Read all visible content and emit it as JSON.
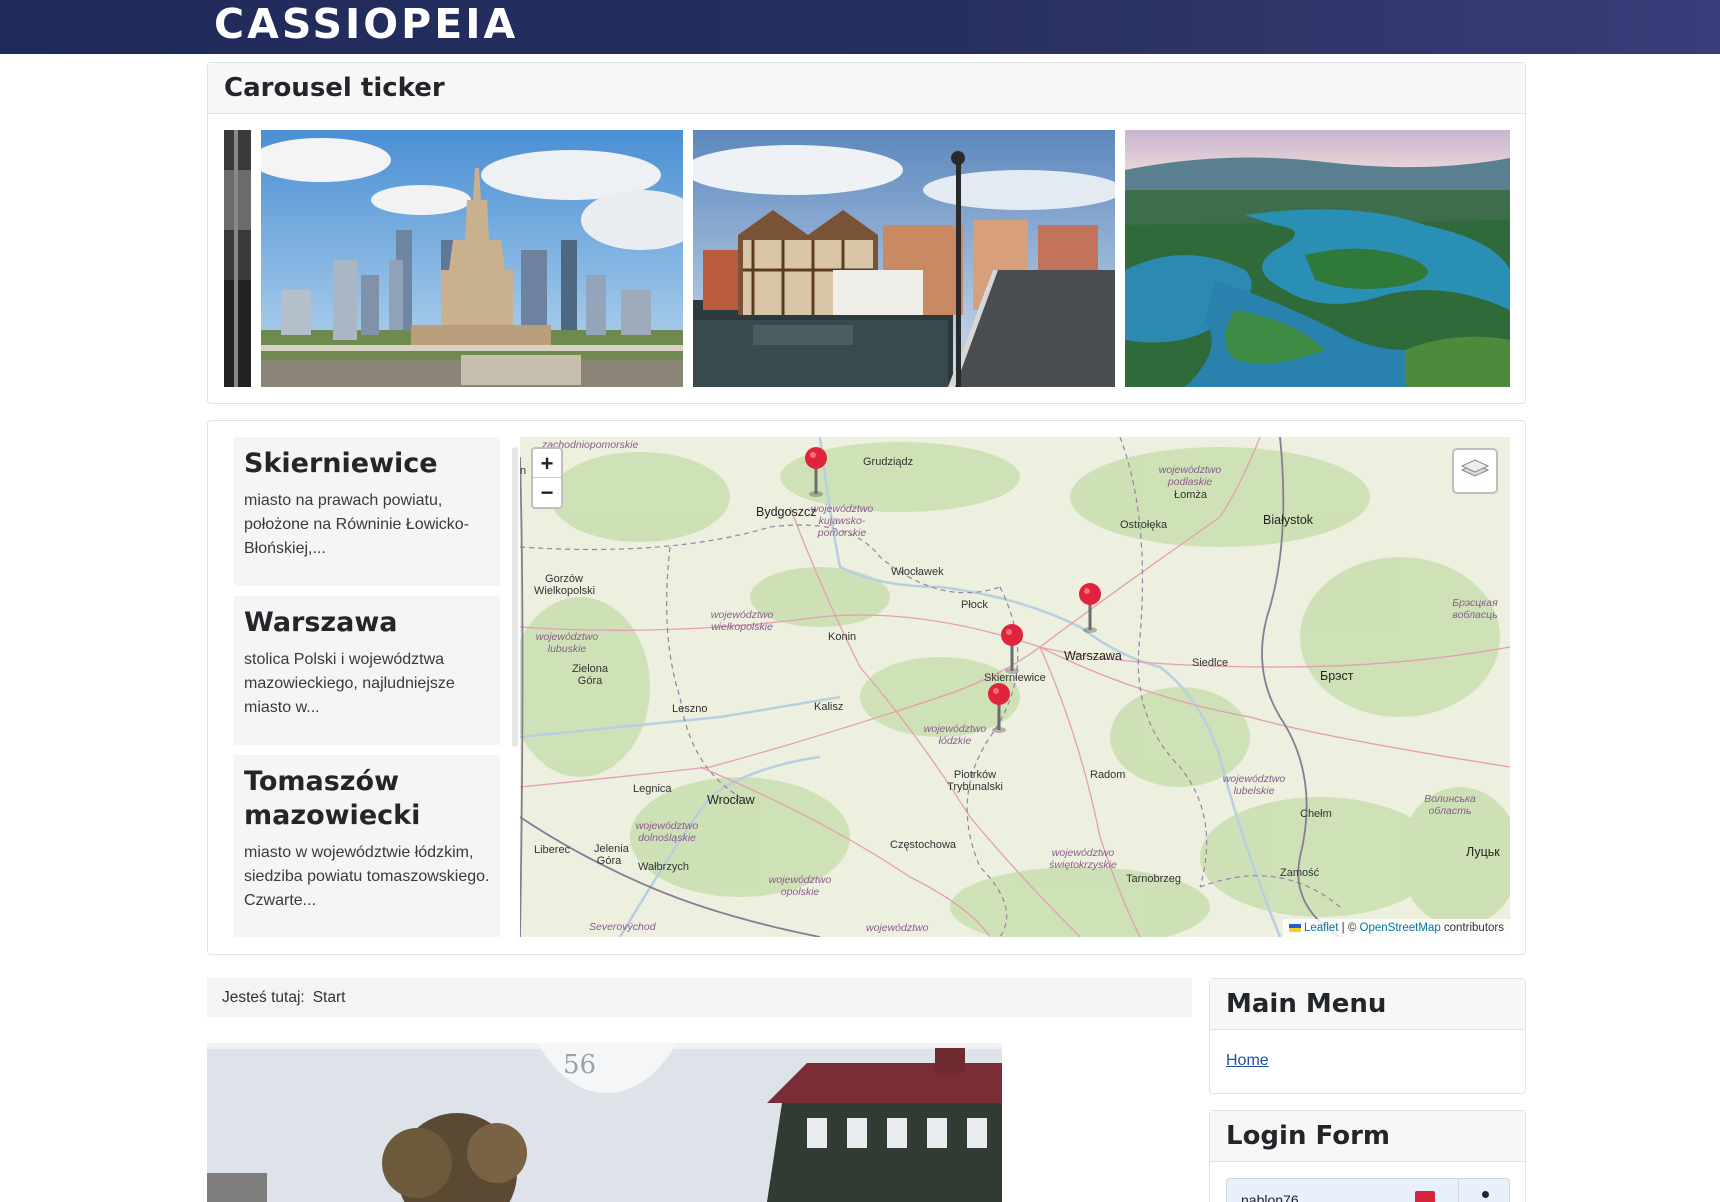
{
  "header": {
    "brand": "CASSIOPEIA"
  },
  "carousel": {
    "title": "Carousel ticker"
  },
  "cities": [
    {
      "name": "Skierniewice",
      "desc": "miasto na prawach powiatu, położone na Równinie Łowicko-Błońskiej,..."
    },
    {
      "name": "Warszawa",
      "desc": "stolica Polski i województwa mazowieckiego, najludniejsze miasto w..."
    },
    {
      "name": "Tomaszów mazowiecki",
      "desc": "miasto w województwie łódzkim, siedziba powiatu tomaszowskiego. Czwarte..."
    }
  ],
  "map": {
    "zoom_in": "+",
    "zoom_out": "−",
    "attribution": {
      "leaflet": "Leaflet",
      "sep": " | © ",
      "osm": "OpenStreetMap",
      "contrib": " contributors"
    },
    "places": {
      "grudziadz": "Grudziądz",
      "bydgoszcz": "Bydgoszcz",
      "lomza": "Łomża",
      "ostroleka": "Ostrołęka",
      "bialystok": "Białystok",
      "gorzow": "Gorzów Wielkopolski",
      "wloclawek": "Włocławek",
      "plock": "Płock",
      "konin": "Konin",
      "warszawa": "Warszawa",
      "siedlce": "Siedlce",
      "brest": "Брэст",
      "zielona": "Zielona Góra",
      "skierniewice": "Skierniewice",
      "leszno": "Leszno",
      "kalisz": "Kalisz",
      "piotrkow": "Piotrków Trybunalski",
      "radom": "Radom",
      "legnica": "Legnica",
      "wroclaw": "Wrocław",
      "chelm": "Chełm",
      "liberec": "Liberec",
      "jelenia": "Jelenia Góra",
      "walbrzych": "Wałbrzych",
      "czestochowa": "Częstochowa",
      "tarnobrzeg": "Tarnobrzeg",
      "zamosc": "Zamość",
      "lutsk": "Луцьк",
      "sev": "Severovýchod",
      "n": "n"
    },
    "regions": {
      "zach": "zachodniopomorskie",
      "kuj": "województwo kujawsko-pomorskie",
      "podl": "województwo podlaskie",
      "wlkp": "województwo wielkopolskie",
      "lub": "województwo lubuskie",
      "brest_obl": "Брэсцкая вобласць",
      "lodz": "województwo łódzkie",
      "lubel": "województwo lubelskie",
      "wolyn": "Волинська область",
      "dolno": "województwo dolnośląskie",
      "swiet": "województwo świętokrzyskie",
      "opol": "województwo opolskie",
      "woj": "województwo"
    }
  },
  "breadcrumb": {
    "label": "Jesteś tutaj:",
    "item": "Start"
  },
  "main_menu": {
    "title": "Main Menu",
    "items": [
      "Home"
    ]
  },
  "login": {
    "title": "Login Form",
    "username": "nablon76"
  },
  "colors": {
    "header": "#1f2a5c",
    "link": "#224faa",
    "pin": "#e0243c"
  }
}
